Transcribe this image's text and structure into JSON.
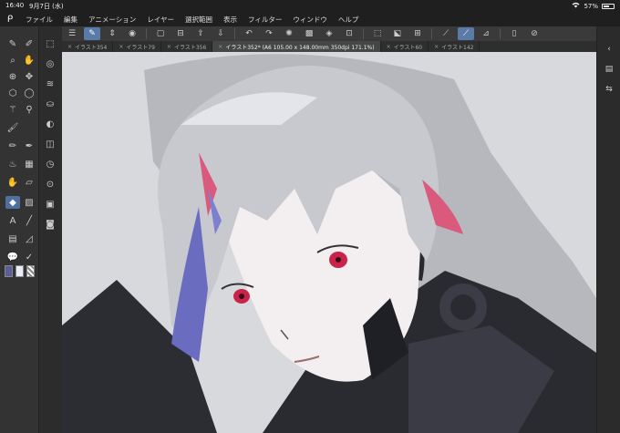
{
  "status": {
    "time": "16:40",
    "date": "9月7日 (水)",
    "battery": "57%"
  },
  "menu": [
    "ファイル",
    "編集",
    "アニメーション",
    "レイヤー",
    "選択範囲",
    "表示",
    "フィルター",
    "ウィンドウ",
    "ヘルプ"
  ],
  "tabs": [
    {
      "label": "イラスト354",
      "active": false
    },
    {
      "label": "イラスト79",
      "active": false
    },
    {
      "label": "イラスト356",
      "active": false
    },
    {
      "label": "イラスト352* (A6 105.00 x 148.00mm 350dpi 171.1%)",
      "active": true
    },
    {
      "label": "イラスト60",
      "active": false
    },
    {
      "label": "イラスト142",
      "active": false
    }
  ],
  "tab_close": "×",
  "colors": {
    "accent": "#5a7aa8",
    "main_swatch": "#5b5c98",
    "sub_swatch": "#e8eef5"
  },
  "icons": {
    "menu": "menu-icon",
    "undo": "undo-icon",
    "redo": "redo-icon",
    "save": "save-icon"
  }
}
